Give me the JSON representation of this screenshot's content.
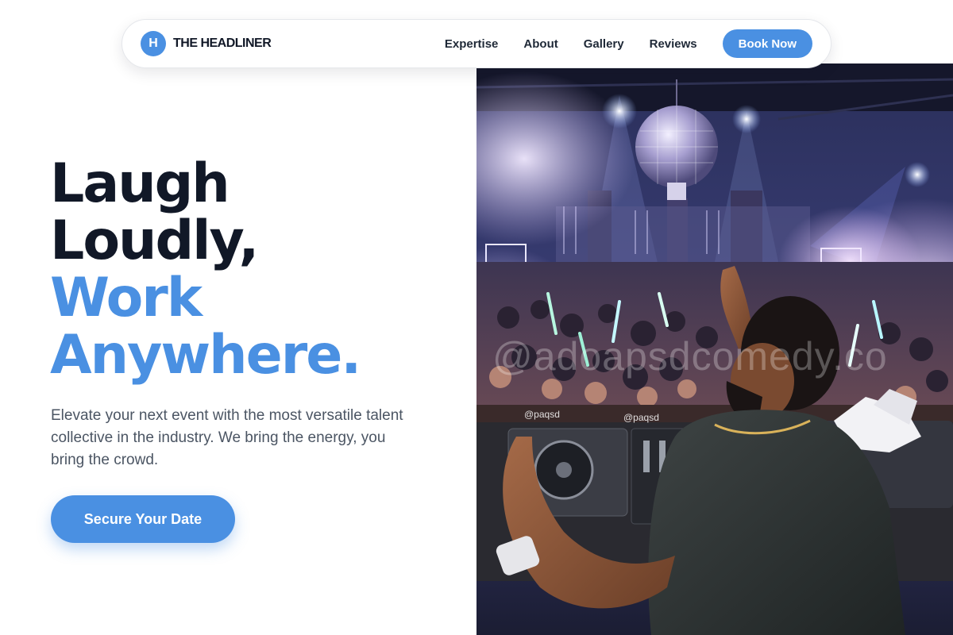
{
  "brand": {
    "logo_letter": "H",
    "name": "THE HEADLINER"
  },
  "nav": {
    "links": [
      "Expertise",
      "About",
      "Gallery",
      "Reviews"
    ],
    "cta_label": "Book Now"
  },
  "hero": {
    "headline_line1": "Laugh",
    "headline_line2": "Loudly,",
    "headline_line3": "Work",
    "headline_line4": "Anywhere.",
    "subtitle": "Elevate your next event with the most versatile talent collective in the industry. We bring the energy, you bring the crowd.",
    "cta_label": "Secure Your Date",
    "image_watermark": "@adoapsdcomedy.co"
  },
  "colors": {
    "accent": "#4a90e2",
    "heading": "#111827",
    "body_text": "#4b5563"
  },
  "icons": {
    "logo": "letter-h-circle"
  }
}
